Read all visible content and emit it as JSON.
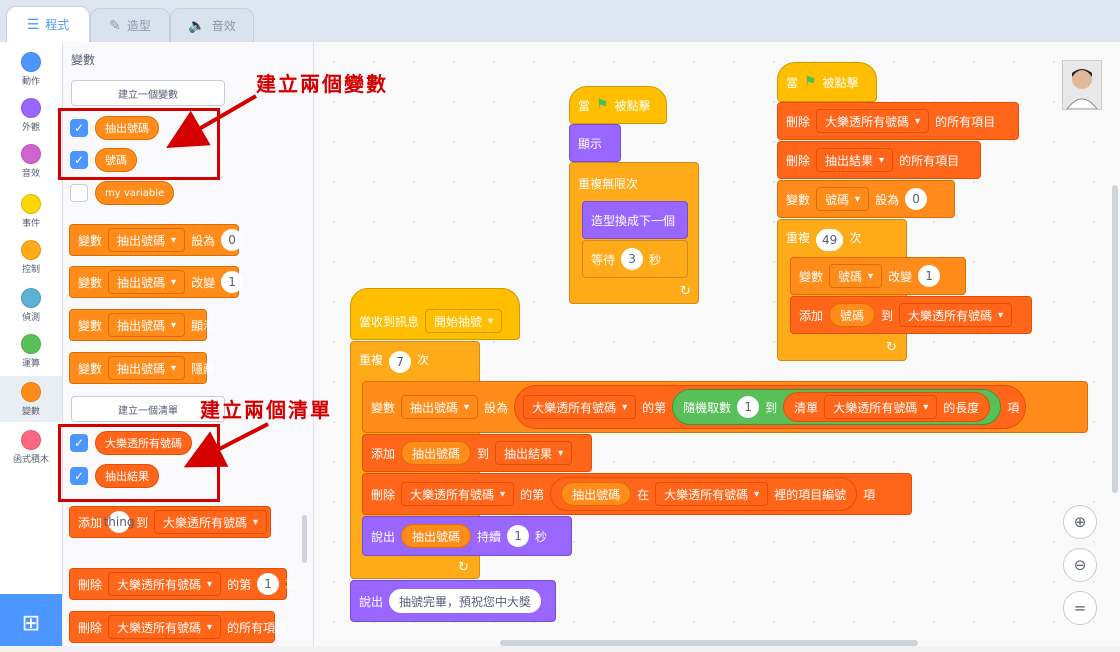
{
  "tabs": [
    {
      "label": "程式",
      "icon": "code-icon",
      "active": true
    },
    {
      "label": "造型",
      "icon": "brush-icon",
      "active": false
    },
    {
      "label": "音效",
      "icon": "speaker-icon",
      "active": false
    }
  ],
  "categories": [
    {
      "label": "動作",
      "color": "#4c97ff"
    },
    {
      "label": "外觀",
      "color": "#9966ff"
    },
    {
      "label": "音效",
      "color": "#cf63cf"
    },
    {
      "label": "事件",
      "color": "#ffd500"
    },
    {
      "label": "控制",
      "color": "#ffab19"
    },
    {
      "label": "偵測",
      "color": "#5cb1d6"
    },
    {
      "label": "運算",
      "color": "#59c059"
    },
    {
      "label": "變數",
      "color": "#ff8c1a"
    },
    {
      "label": "函式積木",
      "color": "#ff6680"
    }
  ],
  "palette": {
    "title": "變數",
    "make_variable": "建立一個變數",
    "make_list": "建立一個清單",
    "variables": [
      "抽出號碼",
      "號碼",
      "my variable"
    ],
    "lists": [
      "大樂透所有號碼",
      "抽出結果"
    ],
    "var_blocks": {
      "kw": "變數",
      "var": "抽出號碼",
      "set": "設為",
      "set_val": "0",
      "change": "改變",
      "change_val": "1",
      "show": "顯示",
      "hide": "隱藏"
    },
    "add_block": {
      "kw": "添加",
      "val": "thing",
      "to": "到",
      "list": "大樂透所有號碼"
    },
    "delete_item": {
      "kw": "刪除",
      "list": "大樂透所有號碼",
      "of": "的第",
      "val": "1",
      "item": "項"
    },
    "delete_all": {
      "kw": "刪除",
      "list": "大樂透所有號碼",
      "suffix": "的所有項目"
    }
  },
  "annotations": {
    "vars": "建立兩個變數",
    "lists": "建立兩個清單"
  },
  "script1": {
    "hat": "當",
    "clicked": "被點擊",
    "show": "顯示",
    "forever": "重複無限次",
    "next_costume": "造型換成下一個",
    "wait": "等待",
    "wait_val": "3",
    "sec": "秒"
  },
  "script2": {
    "hat": "當",
    "clicked": "被點擊",
    "del_all": "刪除",
    "del_list1": "大樂透所有號碼",
    "all_items": "的所有項目",
    "del_list2": "抽出結果",
    "var": "變數",
    "var_name": "號碼",
    "set": "設為",
    "set_val": "0",
    "repeat": "重複",
    "repeat_val": "49",
    "times": "次",
    "change": "改變",
    "change_val": "1",
    "add": "添加",
    "add_var": "號碼",
    "to": "到",
    "add_list": "大樂透所有號碼"
  },
  "script3": {
    "hat": "當收到訊息",
    "msg": "開始抽號",
    "repeat": "重複",
    "repeat_val": "7",
    "times": "次",
    "var": "變數",
    "var_name": "抽出號碼",
    "set": "設為",
    "list": "大樂透所有號碼",
    "item_of": "的第",
    "random": "隨機取數",
    "rand_from": "1",
    "rand_to": "到",
    "length_pre": "清單",
    "length_list": "大樂透所有號碼",
    "length_suf": "的長度",
    "item": "項",
    "add": "添加",
    "add_var": "抽出號碼",
    "add_to": "到",
    "add_list": "抽出結果",
    "del": "刪除",
    "del_list": "大樂透所有號碼",
    "del_of": "的第",
    "in": "在",
    "in_list": "大樂透所有號碼",
    "idx": "裡的項目編號",
    "idx_item": "項",
    "say": "說出",
    "say_var": "抽出號碼",
    "say_for": "持續",
    "say_val": "1",
    "say_sec": "秒",
    "say_final": "說出",
    "final_text": "抽號完畢，預祝您中大獎"
  },
  "zoom": [
    "zoom-in-icon",
    "zoom-out-icon",
    "zoom-reset-icon"
  ]
}
